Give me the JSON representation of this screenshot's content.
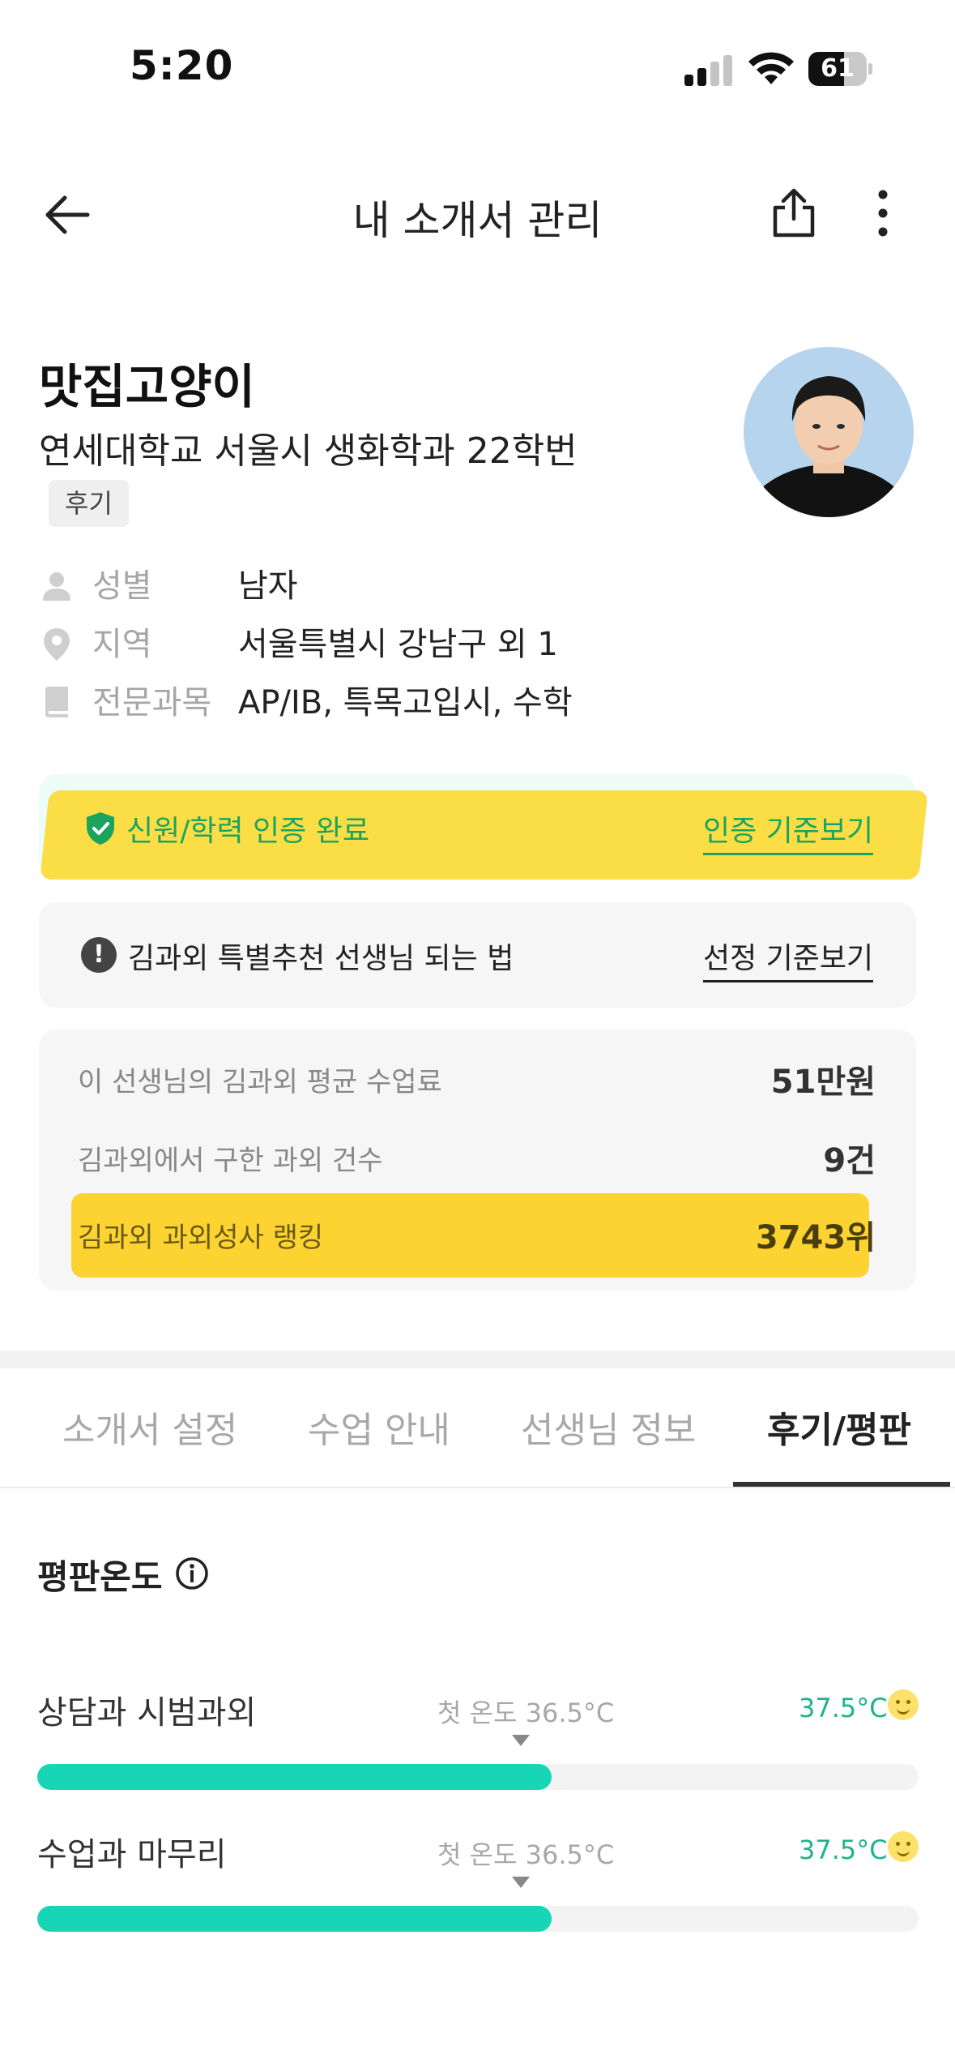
{
  "status_bar": {
    "time": "5:20",
    "battery": "61",
    "battery_level": 0.61
  },
  "nav": {
    "title": "내 소개서 관리"
  },
  "profile": {
    "name": "맛집고양이",
    "school": "연세대학교 서울시 생화학과 22학번",
    "badge": "후기",
    "info": [
      {
        "label": "성별",
        "value": "남자",
        "icon": "person-icon"
      },
      {
        "label": "지역",
        "value": "서울특별시 강남구 외 1",
        "icon": "location-pin-icon"
      },
      {
        "label": "전문과목",
        "value": "AP/IB, 특목고입시, 수학",
        "icon": "book-icon"
      }
    ]
  },
  "verification": {
    "text": "신원/학력 인증 완료",
    "link": "인증 기준보기"
  },
  "special": {
    "text": "김과외 특별추천 선생님 되는 법",
    "link": "선정 기준보기"
  },
  "stats": [
    {
      "label": "이 선생님의 김과외 평균 수업료",
      "value": "51만원"
    },
    {
      "label": "김과외에서 구한 과외 건수",
      "value": "9건"
    },
    {
      "label": "김과외 과외성사 랭킹",
      "value": "3743위"
    }
  ],
  "tabs": [
    {
      "label": "소개서 설정",
      "active": false
    },
    {
      "label": "수업 안내",
      "active": false
    },
    {
      "label": "선생님 정보",
      "active": false
    },
    {
      "label": "후기/평판",
      "active": true
    }
  ],
  "reputation": {
    "title": "평판온도",
    "rows": [
      {
        "label": "상담과 시범과외",
        "start_label": "첫 온도 36.5°C",
        "value": "37.5°C",
        "level": 0.584
      },
      {
        "label": "수업과 마무리",
        "start_label": "첫 온도 36.5°C",
        "value": "37.5°C",
        "level": 0.584
      }
    ]
  },
  "colors": {
    "accent_green": "#1ba45d",
    "temp_fill": "#18d6b5",
    "highlight_yellow": "#fbdc3b"
  }
}
